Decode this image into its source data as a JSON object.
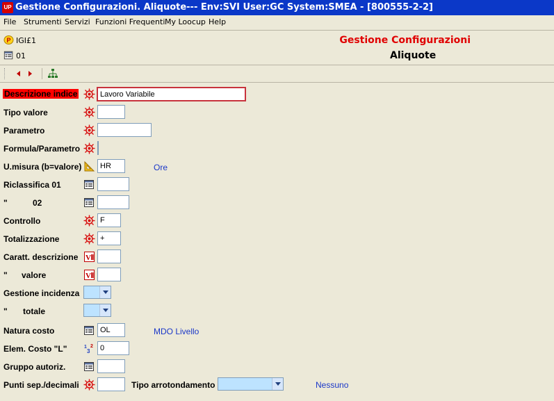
{
  "window": {
    "app_icon_text": "UP",
    "title": "Gestione Configurazioni. Aliquote--- Env:SVI User:GC System:SMEA - [800555-2-2]"
  },
  "menu": [
    "File",
    "Strumenti",
    "Servizi",
    "Funzioni Frequenti",
    "My Loocup",
    "Help"
  ],
  "header": {
    "code1": "IGI£1",
    "code2": "01",
    "title": "Gestione Configurazioni",
    "subtitle": "Aliquote"
  },
  "form": {
    "descrizione_indice": {
      "label": "Descrizione indice",
      "value": "Lavoro   Variabile"
    },
    "tipo_valore": {
      "label": "Tipo valore",
      "value": ""
    },
    "parametro": {
      "label": "Parametro",
      "value": ""
    },
    "formula_parametro": {
      "label": "Formula/Parametro",
      "value": ""
    },
    "umisura": {
      "label": "U.misura (b=valore)",
      "value": "HR",
      "desc": "Ore"
    },
    "riclassifica01": {
      "label": "Riclassifica 01",
      "value": ""
    },
    "riclassifica02": {
      "label_quote": "\"",
      "label_num": "02",
      "value": ""
    },
    "controllo": {
      "label": "Controllo",
      "value": "F"
    },
    "totalizzazione": {
      "label": "Totalizzazione",
      "value": "+"
    },
    "caratt_descrizione": {
      "label": "Caratt. descrizione",
      "value": ""
    },
    "caratt_valore": {
      "label_quote": "\"",
      "label_text": "valore",
      "value": ""
    },
    "gestione_incidenza": {
      "label": "Gestione incidenza",
      "value": ""
    },
    "gestione_totale": {
      "label_quote": "\"",
      "label_text": "totale",
      "value": ""
    },
    "natura_costo": {
      "label": "Natura costo",
      "value": "OL",
      "desc": "MDO Livello"
    },
    "elem_costo": {
      "label": "Elem. Costo \"L\"",
      "value": "0"
    },
    "gruppo_autoriz": {
      "label": "Gruppo autoriz.",
      "value": ""
    },
    "punti_sep": {
      "label": "Punti sep./decimali",
      "value": ""
    },
    "tipo_arrotondamento": {
      "label": "Tipo arrotondamento",
      "value": "",
      "desc": "Nessuno"
    }
  },
  "colors": {
    "title_red": "#e00000",
    "desc_blue": "#1a37c8",
    "highlight": "#ff0000",
    "titlebar": "#0b38c8"
  },
  "icons": {
    "required": "red-asterisk-icon",
    "table": "table-grid-icon",
    "measure": "ruler-triangle-icon",
    "variable": "v-variable-icon",
    "numbers": "numbers-123-icon"
  }
}
